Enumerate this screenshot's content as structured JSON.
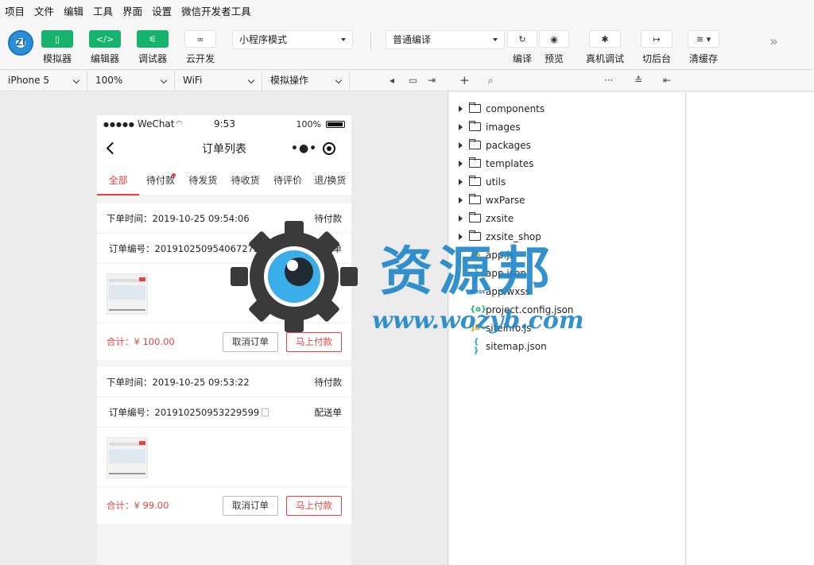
{
  "menubar": [
    "项目",
    "文件",
    "编辑",
    "工具",
    "界面",
    "设置",
    "微信开发者工具"
  ],
  "toolbar": {
    "logo_text": "ZI",
    "simulator": "模拟器",
    "editor": "编辑器",
    "debugger": "调试器",
    "cloud": "云开发",
    "mode_select": "小程序模式",
    "compile_select": "普通编译",
    "compile": "编译",
    "preview": "预览",
    "remote_debug": "真机调试",
    "background": "切后台",
    "clear_cache": "清缓存"
  },
  "simbar": {
    "device": "iPhone 5",
    "zoom": "100%",
    "network": "WiFi",
    "operation": "模拟操作"
  },
  "phone": {
    "status": {
      "signal": "●●●●●",
      "carrier": "WeChat",
      "time": "9:53",
      "battery": "100%"
    },
    "nav_title": "订单列表",
    "tabs": [
      "全部",
      "待付款",
      "待发货",
      "待收货",
      "待评价",
      "退/换货"
    ],
    "orders": [
      {
        "time": "下单时间：2019-10-25 09:54:06",
        "status": "待付款",
        "number": "订单编号：201910250954067275",
        "delivery": "配送单",
        "total": "合计：¥ 100.00",
        "cancel": "取消订单",
        "pay": "马上付款"
      },
      {
        "time": "下单时间：2019-10-25 09:53:22",
        "status": "待付款",
        "number": "订单编号：201910250953229599",
        "delivery": "配送单",
        "total": "合计：¥ 99.00",
        "cancel": "取消订单",
        "pay": "马上付款"
      }
    ]
  },
  "files": {
    "folders": [
      "components",
      "images",
      "packages",
      "templates",
      "utils",
      "wxParse",
      "zxsite",
      "zxsite_shop"
    ],
    "files": [
      {
        "icon": "JS",
        "name": "app.js"
      },
      {
        "icon": "{ }",
        "name": "app.json"
      },
      {
        "icon": "wxss",
        "name": "app.wxss"
      },
      {
        "icon": "{o}",
        "name": "project.config.json"
      },
      {
        "icon": "JS",
        "name": "siteinfo.js"
      },
      {
        "icon": "{ }",
        "name": "sitemap.json"
      }
    ]
  },
  "watermark": {
    "title": "资源邦",
    "url": "www.wozyb.com"
  },
  "colors": {
    "accent_green": "#17b26d",
    "accent_red": "#e64340",
    "watermark_blue": "#1d86c9"
  }
}
